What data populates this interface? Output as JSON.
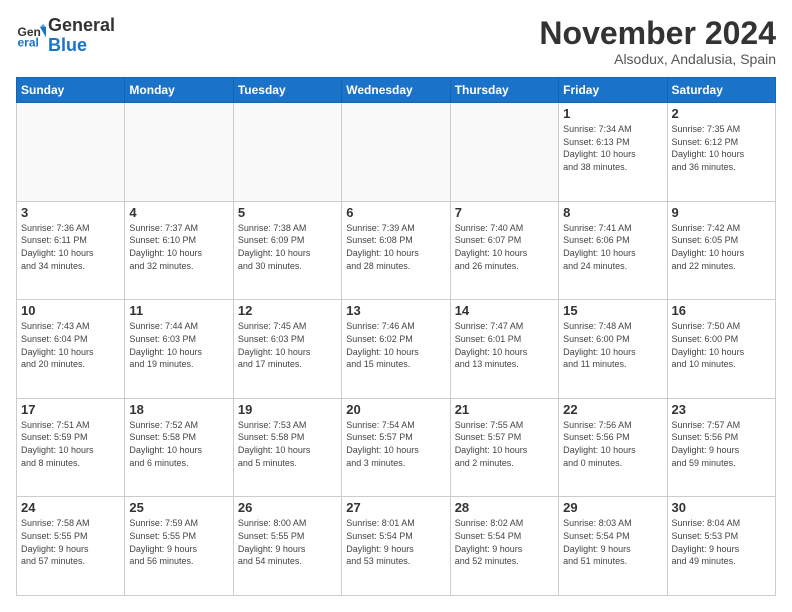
{
  "logo": {
    "line1": "General",
    "line2": "Blue"
  },
  "title": "November 2024",
  "subtitle": "Alsodux, Andalusia, Spain",
  "days_of_week": [
    "Sunday",
    "Monday",
    "Tuesday",
    "Wednesday",
    "Thursday",
    "Friday",
    "Saturday"
  ],
  "weeks": [
    [
      {
        "day": "",
        "info": ""
      },
      {
        "day": "",
        "info": ""
      },
      {
        "day": "",
        "info": ""
      },
      {
        "day": "",
        "info": ""
      },
      {
        "day": "",
        "info": ""
      },
      {
        "day": "1",
        "info": "Sunrise: 7:34 AM\nSunset: 6:13 PM\nDaylight: 10 hours\nand 38 minutes."
      },
      {
        "day": "2",
        "info": "Sunrise: 7:35 AM\nSunset: 6:12 PM\nDaylight: 10 hours\nand 36 minutes."
      }
    ],
    [
      {
        "day": "3",
        "info": "Sunrise: 7:36 AM\nSunset: 6:11 PM\nDaylight: 10 hours\nand 34 minutes."
      },
      {
        "day": "4",
        "info": "Sunrise: 7:37 AM\nSunset: 6:10 PM\nDaylight: 10 hours\nand 32 minutes."
      },
      {
        "day": "5",
        "info": "Sunrise: 7:38 AM\nSunset: 6:09 PM\nDaylight: 10 hours\nand 30 minutes."
      },
      {
        "day": "6",
        "info": "Sunrise: 7:39 AM\nSunset: 6:08 PM\nDaylight: 10 hours\nand 28 minutes."
      },
      {
        "day": "7",
        "info": "Sunrise: 7:40 AM\nSunset: 6:07 PM\nDaylight: 10 hours\nand 26 minutes."
      },
      {
        "day": "8",
        "info": "Sunrise: 7:41 AM\nSunset: 6:06 PM\nDaylight: 10 hours\nand 24 minutes."
      },
      {
        "day": "9",
        "info": "Sunrise: 7:42 AM\nSunset: 6:05 PM\nDaylight: 10 hours\nand 22 minutes."
      }
    ],
    [
      {
        "day": "10",
        "info": "Sunrise: 7:43 AM\nSunset: 6:04 PM\nDaylight: 10 hours\nand 20 minutes."
      },
      {
        "day": "11",
        "info": "Sunrise: 7:44 AM\nSunset: 6:03 PM\nDaylight: 10 hours\nand 19 minutes."
      },
      {
        "day": "12",
        "info": "Sunrise: 7:45 AM\nSunset: 6:03 PM\nDaylight: 10 hours\nand 17 minutes."
      },
      {
        "day": "13",
        "info": "Sunrise: 7:46 AM\nSunset: 6:02 PM\nDaylight: 10 hours\nand 15 minutes."
      },
      {
        "day": "14",
        "info": "Sunrise: 7:47 AM\nSunset: 6:01 PM\nDaylight: 10 hours\nand 13 minutes."
      },
      {
        "day": "15",
        "info": "Sunrise: 7:48 AM\nSunset: 6:00 PM\nDaylight: 10 hours\nand 11 minutes."
      },
      {
        "day": "16",
        "info": "Sunrise: 7:50 AM\nSunset: 6:00 PM\nDaylight: 10 hours\nand 10 minutes."
      }
    ],
    [
      {
        "day": "17",
        "info": "Sunrise: 7:51 AM\nSunset: 5:59 PM\nDaylight: 10 hours\nand 8 minutes."
      },
      {
        "day": "18",
        "info": "Sunrise: 7:52 AM\nSunset: 5:58 PM\nDaylight: 10 hours\nand 6 minutes."
      },
      {
        "day": "19",
        "info": "Sunrise: 7:53 AM\nSunset: 5:58 PM\nDaylight: 10 hours\nand 5 minutes."
      },
      {
        "day": "20",
        "info": "Sunrise: 7:54 AM\nSunset: 5:57 PM\nDaylight: 10 hours\nand 3 minutes."
      },
      {
        "day": "21",
        "info": "Sunrise: 7:55 AM\nSunset: 5:57 PM\nDaylight: 10 hours\nand 2 minutes."
      },
      {
        "day": "22",
        "info": "Sunrise: 7:56 AM\nSunset: 5:56 PM\nDaylight: 10 hours\nand 0 minutes."
      },
      {
        "day": "23",
        "info": "Sunrise: 7:57 AM\nSunset: 5:56 PM\nDaylight: 9 hours\nand 59 minutes."
      }
    ],
    [
      {
        "day": "24",
        "info": "Sunrise: 7:58 AM\nSunset: 5:55 PM\nDaylight: 9 hours\nand 57 minutes."
      },
      {
        "day": "25",
        "info": "Sunrise: 7:59 AM\nSunset: 5:55 PM\nDaylight: 9 hours\nand 56 minutes."
      },
      {
        "day": "26",
        "info": "Sunrise: 8:00 AM\nSunset: 5:55 PM\nDaylight: 9 hours\nand 54 minutes."
      },
      {
        "day": "27",
        "info": "Sunrise: 8:01 AM\nSunset: 5:54 PM\nDaylight: 9 hours\nand 53 minutes."
      },
      {
        "day": "28",
        "info": "Sunrise: 8:02 AM\nSunset: 5:54 PM\nDaylight: 9 hours\nand 52 minutes."
      },
      {
        "day": "29",
        "info": "Sunrise: 8:03 AM\nSunset: 5:54 PM\nDaylight: 9 hours\nand 51 minutes."
      },
      {
        "day": "30",
        "info": "Sunrise: 8:04 AM\nSunset: 5:53 PM\nDaylight: 9 hours\nand 49 minutes."
      }
    ]
  ]
}
